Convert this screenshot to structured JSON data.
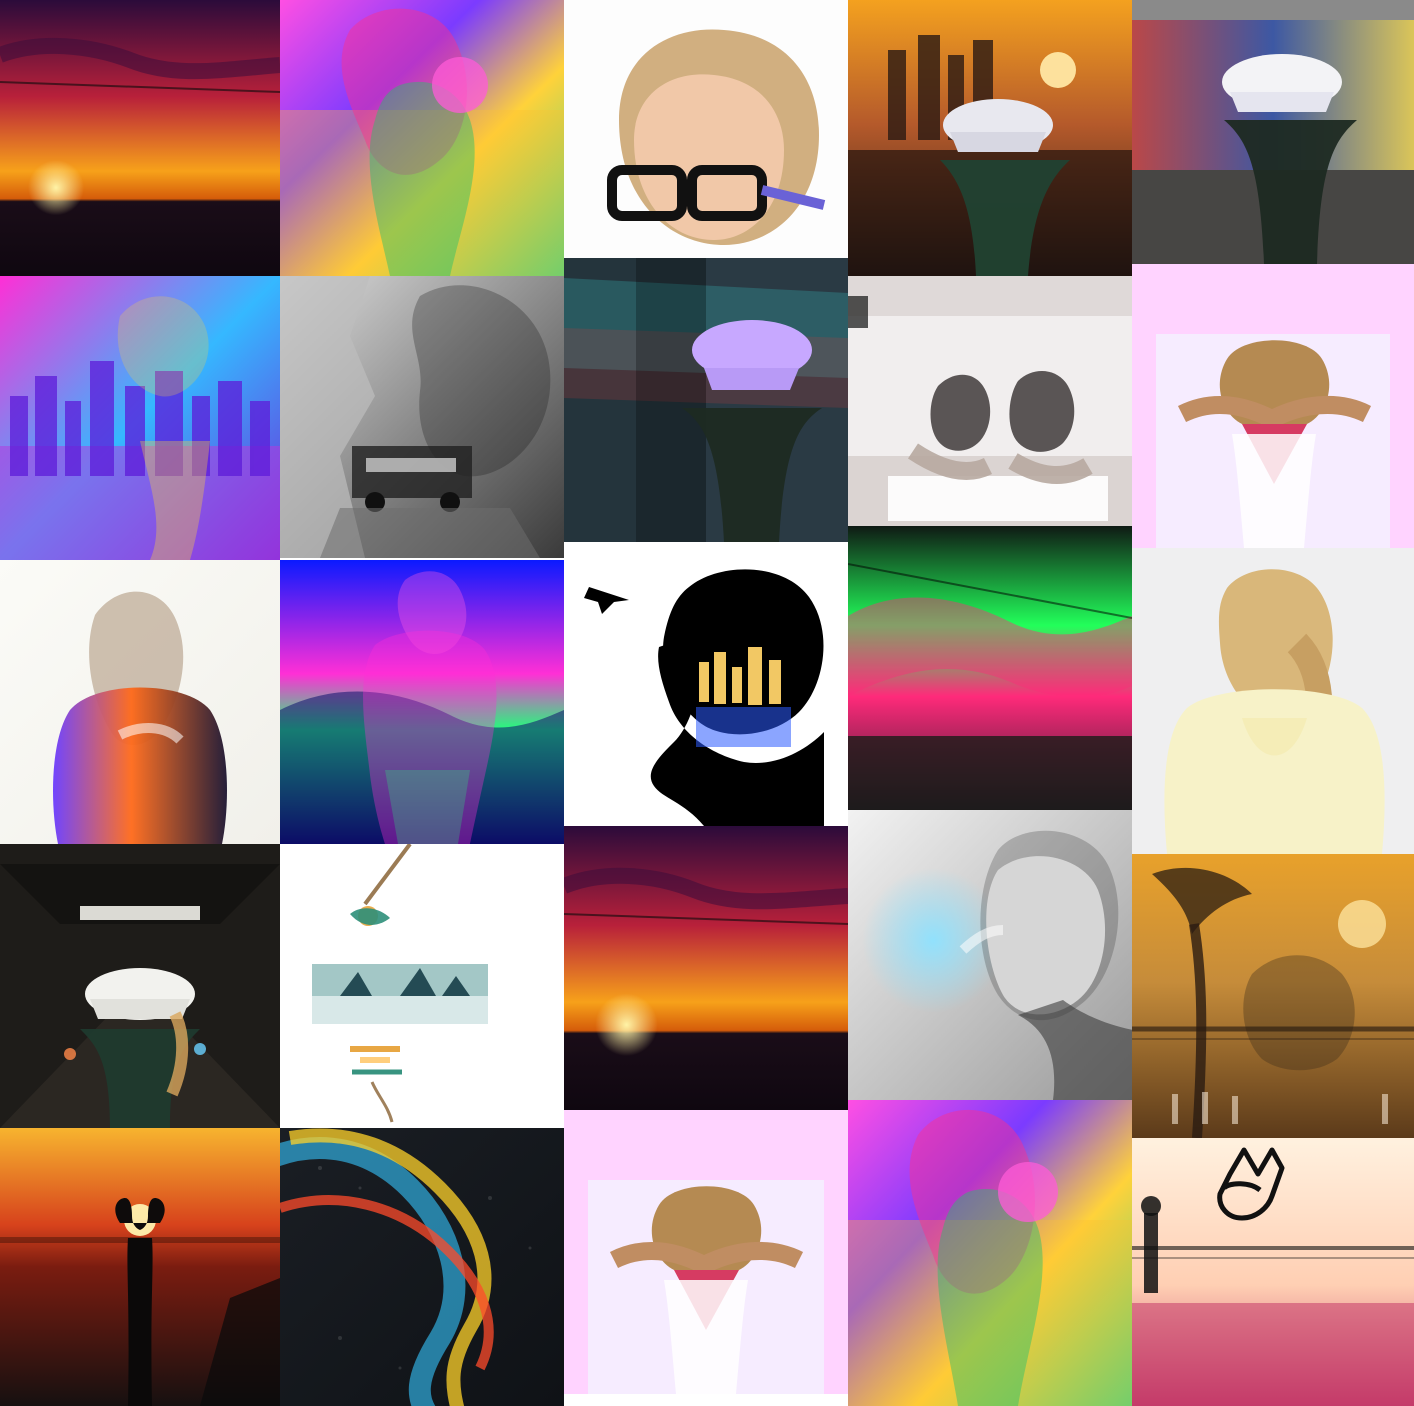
{
  "gallery": {
    "columns": [
      {
        "tiles": [
          {
            "kind": "sunset-sky",
            "colors": [
              "#2b0b3a",
              "#b8203a",
              "#f7a11a",
              "#1a0d18"
            ]
          },
          {
            "kind": "city-double-exposure",
            "colors": [
              "#ff2fd6",
              "#35b8ff",
              "#6d2bd8",
              "#b23adf"
            ]
          },
          {
            "kind": "light-leak-portrait",
            "colors": [
              "#fbfbf7",
              "#6a3cff",
              "#ff6a1a",
              "#1b1430"
            ]
          },
          {
            "kind": "tunnel-cap-girl",
            "colors": [
              "#0c0b0a",
              "#3a332a",
              "#f2f2ee",
              "#1f3a2e"
            ]
          },
          {
            "kind": "sunset-sea-silhouette",
            "colors": [
              "#f7b42f",
              "#d7421c",
              "#7a1c10",
              "#161010"
            ]
          }
        ]
      },
      {
        "tiles": [
          {
            "kind": "rainbow-glitch-girl",
            "colors": [
              "#ff4fe3",
              "#7b3bff",
              "#ffd23a",
              "#2ad68c"
            ]
          },
          {
            "kind": "bw-car-rocks",
            "colors": [
              "#dedede",
              "#8b8b8b",
              "#3a3a3a",
              "#141414"
            ]
          },
          {
            "kind": "neon-blue-sky-girl",
            "colors": [
              "#0b1aff",
              "#ff2fd6",
              "#20ff7a",
              "#0a0a60"
            ]
          },
          {
            "kind": "shark-fins-swing",
            "colors": [
              "#ffffff",
              "#8cb9b8",
              "#244b54",
              "#e7a33a"
            ]
          },
          {
            "kind": "rainbow-glitter-road",
            "colors": [
              "#1a1e24",
              "#ffd12a",
              "#ff4b2b",
              "#36c6ff"
            ]
          }
        ]
      },
      {
        "tiles": [
          {
            "kind": "braid-glasses-portrait",
            "colors": [
              "#fdfdfd",
              "#c9a16a",
              "#111111",
              "#6a62d6"
            ]
          },
          {
            "kind": "graffiti-split-girl",
            "colors": [
              "#1b2a33",
              "#38c9c6",
              "#c33c3c",
              "#c7a8ff"
            ]
          },
          {
            "kind": "silhouette-city-airplane",
            "colors": [
              "#ffffff",
              "#000000",
              "#ffd36a",
              "#2b5bff"
            ]
          },
          {
            "kind": "sunset-sky",
            "colors": [
              "#2b0b3a",
              "#b8203a",
              "#f7a11a",
              "#1a0d18"
            ]
          },
          {
            "kind": "pink-hands-bandana",
            "colors": [
              "#ffd3ff",
              "#f4f0ff",
              "#b58a52",
              "#d63b62"
            ]
          }
        ]
      },
      {
        "tiles": [
          {
            "kind": "la-sunset-cap-girl",
            "colors": [
              "#f4a11f",
              "#b55a2b",
              "#2a1b16",
              "#e8e8ef"
            ]
          },
          {
            "kind": "balcony-two-girls",
            "colors": [
              "#f1eeee",
              "#c9c0bc",
              "#3f3a39",
              "#b7a8a0"
            ]
          },
          {
            "kind": "green-neon-clouds",
            "colors": [
              "#22ff5a",
              "#ff2a7a",
              "#2a1a2c",
              "#1a1c18"
            ]
          },
          {
            "kind": "bw-smoke-braid",
            "colors": [
              "#f2f2f2",
              "#9a9a9a",
              "#2b2b2b",
              "#8ee2ff"
            ]
          },
          {
            "kind": "rainbow-glitch-girl",
            "colors": [
              "#ff4fe3",
              "#7b3bff",
              "#ffd23a",
              "#2ad68c"
            ]
          }
        ]
      },
      {
        "tiles": [
          {
            "kind": "graffiti-cap-girl",
            "colors": [
              "#c33c3c",
              "#2f4fa8",
              "#e9d050",
              "#1d2a22"
            ]
          },
          {
            "kind": "pink-hands-bandana",
            "colors": [
              "#ffd3ff",
              "#f4f0ff",
              "#b58a52",
              "#d63b62"
            ]
          },
          {
            "kind": "ponytail-cream-sweater",
            "colors": [
              "#efeff0",
              "#f7f2c8",
              "#d9b77a",
              "#6c5f55"
            ]
          },
          {
            "kind": "golden-harbor-palm",
            "colors": [
              "#e8a12b",
              "#c68c3a",
              "#5b3a1a",
              "#2a1c11"
            ]
          },
          {
            "kind": "peace-sign-beach",
            "colors": [
              "#fff1df",
              "#ffcfb3",
              "#c43b69",
              "#111111"
            ]
          }
        ]
      }
    ]
  }
}
